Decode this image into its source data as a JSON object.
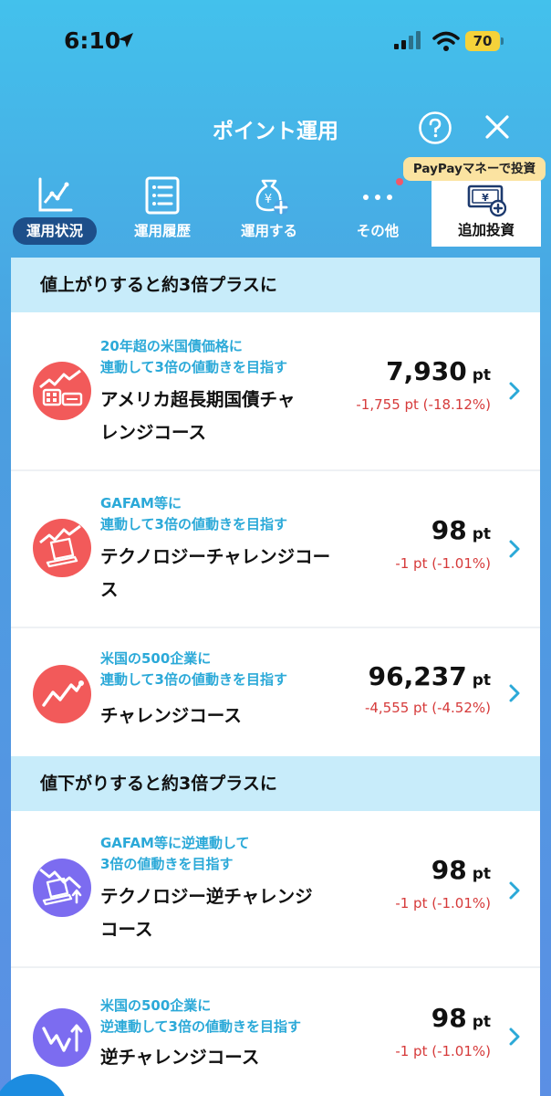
{
  "status_bar": {
    "time": "6:10",
    "battery": "70"
  },
  "header": {
    "title": "ポイント運用"
  },
  "tabs": [
    {
      "label": "運用状況",
      "icon": "line-chart-icon",
      "active": true
    },
    {
      "label": "運用履歴",
      "icon": "list-icon"
    },
    {
      "label": "運用する",
      "icon": "yen-bag-plus-icon"
    },
    {
      "label": "その他",
      "icon": "more-dots-icon"
    },
    {
      "label": "追加投資",
      "icon": "yen-bill-plus-icon",
      "badge": "PayPayマネーで投資"
    }
  ],
  "sections": [
    {
      "title": "値上がりすると約3倍プラスに",
      "courses": [
        {
          "subtitle": "20年超の米国債価格に\n連動して3倍の値動きを目指す",
          "name": "アメリカ超長期国債チャ\nレンジコース",
          "points": "7,930",
          "unit": "pt",
          "change": "-1,755 pt (-18.12%)",
          "icon": "us-bond-chart-icon"
        },
        {
          "subtitle": "GAFAM等に\n連動して3倍の値動きを目指す",
          "name": "テクノロジーチャレンジコー\nス",
          "points": "98",
          "unit": "pt",
          "change": "-1 pt (-1.01%)",
          "icon": "tech-laptop-chart-icon"
        },
        {
          "subtitle": "米国の500企業に\n連動して3倍の値動きを目指す",
          "name": "チャレンジコース",
          "points": "96,237",
          "unit": "pt",
          "change": "-4,555 pt (-4.52%)",
          "icon": "rising-line-icon"
        }
      ]
    },
    {
      "title": "値下がりすると約3倍プラスに",
      "courses": [
        {
          "subtitle": "GAFAM等に逆連動して\n3倍の値動きを目指す",
          "name": "テクノロジー逆チャレンジ\nコース",
          "points": "98",
          "unit": "pt",
          "change": "-1 pt (-1.01%)",
          "icon": "tech-laptop-inverse-icon"
        },
        {
          "subtitle": "米国の500企業に\n逆連動して3倍の値動きを目指す",
          "name": "逆チャレンジコース",
          "points": "98",
          "unit": "pt",
          "change": "-1 pt (-1.01%)",
          "icon": "falling-line-icon"
        }
      ]
    }
  ],
  "colors": {
    "accent_text": "#2ba9d8",
    "negative": "#d63a3a",
    "icon_red": "#f25a5a",
    "icon_purple": "#7c6cf0",
    "section_bg": "#c8ecfa"
  }
}
